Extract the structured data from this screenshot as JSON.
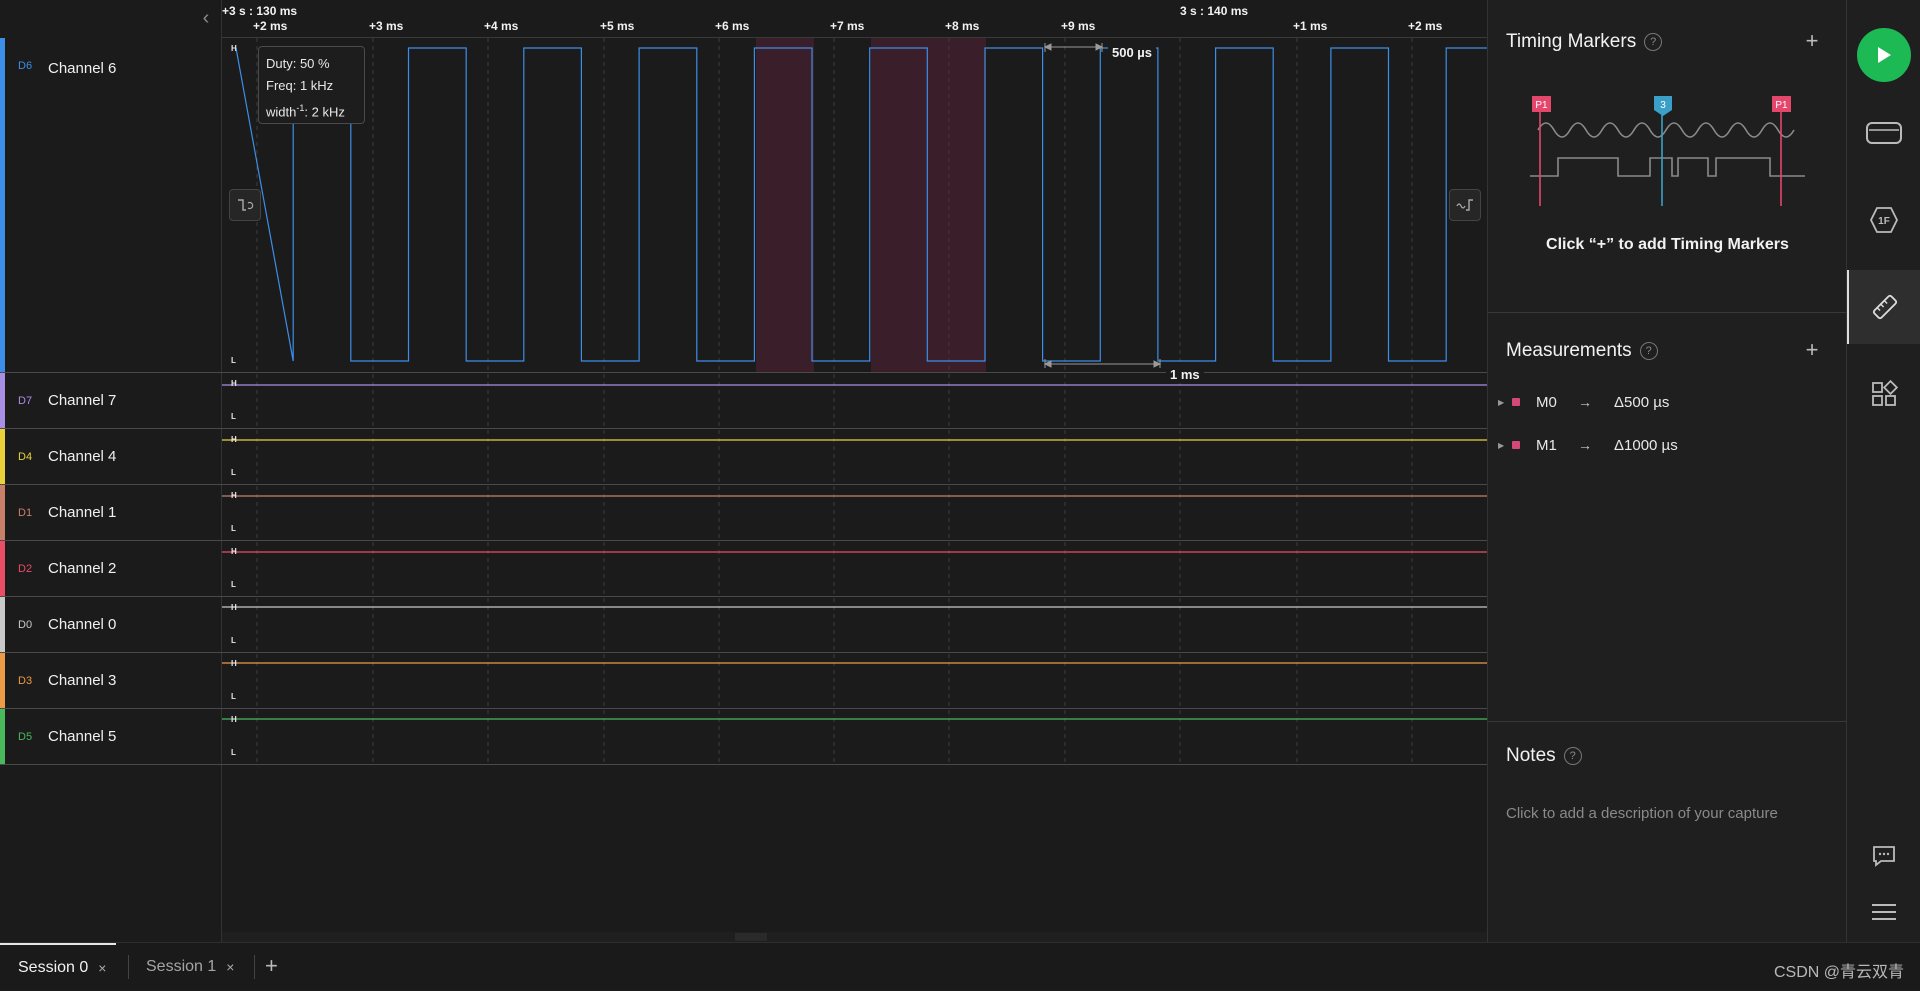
{
  "ruler": {
    "anchor_left": "+3 s : 130 ms",
    "anchor_right": "3 s : 140 ms",
    "ticks": [
      "+2 ms",
      "+3 ms",
      "+4 ms",
      "+5 ms",
      "+6 ms",
      "+7 ms",
      "+8 ms",
      "+9 ms",
      "+1 ms",
      "+2 ms"
    ]
  },
  "channels": [
    {
      "id": "D6",
      "name": "Channel 6",
      "color": "#3d8ee8"
    },
    {
      "id": "D7",
      "name": "Channel 7",
      "color": "#a98ee6"
    },
    {
      "id": "D4",
      "name": "Channel 4",
      "color": "#e9d13a"
    },
    {
      "id": "D1",
      "name": "Channel 1",
      "color": "#c9806b"
    },
    {
      "id": "D2",
      "name": "Channel 2",
      "color": "#ea4d65"
    },
    {
      "id": "D0",
      "name": "Channel 0",
      "color": "#c9c9c9"
    },
    {
      "id": "D3",
      "name": "Channel 3",
      "color": "#ec9a45"
    },
    {
      "id": "D5",
      "name": "Channel 5",
      "color": "#4ab95c"
    }
  ],
  "level_labels": {
    "high": "H",
    "low": "L"
  },
  "tooltip": {
    "duty": "Duty: 50 %",
    "freq": "Freq: 1 kHz",
    "width_prefix": "width",
    "width_sup": "-1",
    "width_value": ": 2 kHz"
  },
  "measure_labels": {
    "top": "500 µs",
    "bottom": "1 ms"
  },
  "icons": {
    "collapse": "chevron-left-icon",
    "edge_left": "falling-edge-icon",
    "edge_right": "rising-edge-icon"
  },
  "timing_markers": {
    "title": "Timing Markers",
    "help": "?",
    "add": "+",
    "marker_left": "P1",
    "marker_mid": "3",
    "marker_right": "P1",
    "hint": "Click “+” to add Timing Markers"
  },
  "measurements": {
    "title": "Measurements",
    "help": "?",
    "add": "+",
    "items": [
      {
        "name": "M0",
        "value": "Δ500 µs"
      },
      {
        "name": "M1",
        "value": "Δ1000 µs"
      }
    ]
  },
  "notes": {
    "title": "Notes",
    "help": "?",
    "placeholder": "Click to add a description of your capture"
  },
  "rail": [
    "play-icon",
    "device-icon",
    "analyzer-1f-icon",
    "ruler-icon",
    "extensions-icon",
    "chat-icon",
    "menu-icon"
  ],
  "tabs": [
    {
      "label": "Session 0",
      "close": "×"
    },
    {
      "label": "Session 1",
      "close": "×"
    }
  ],
  "tab_add": "+",
  "watermark": "CSDN @青云双青",
  "accent": {
    "play": "#1db954",
    "highlight": "#3a1f2a",
    "measurement": "#d24a75"
  }
}
